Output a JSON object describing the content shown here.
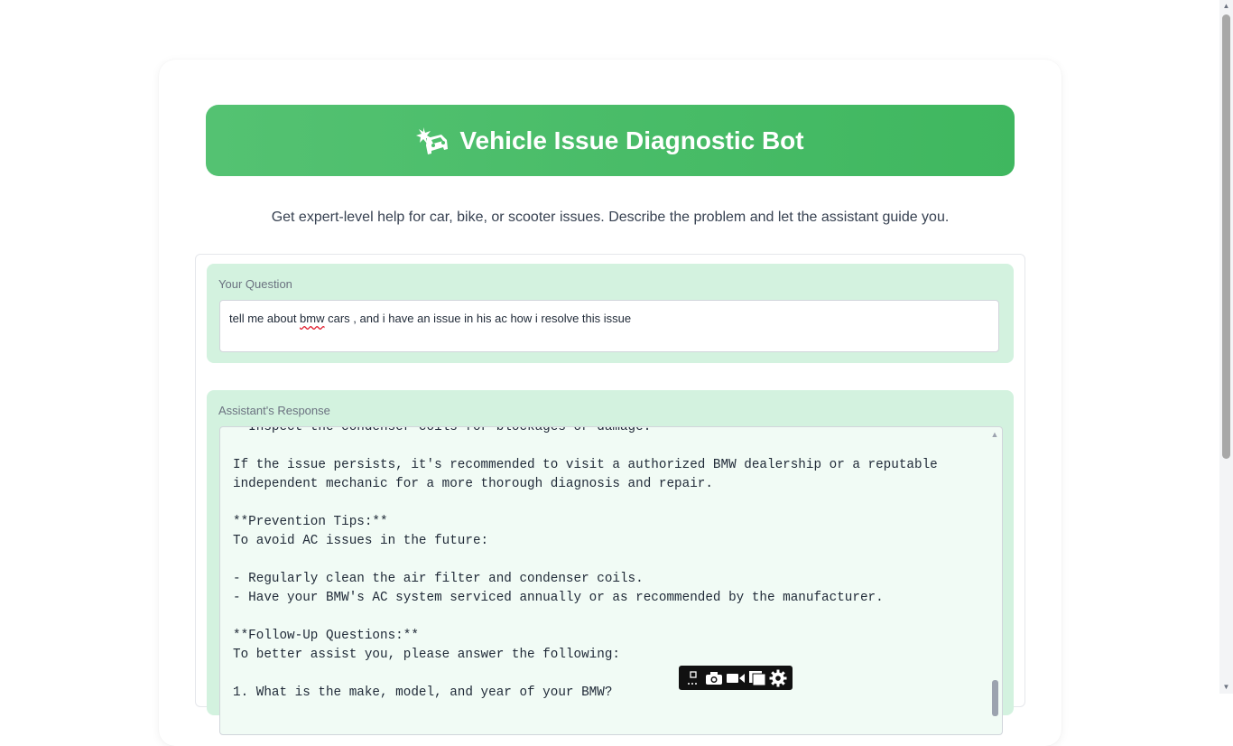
{
  "header": {
    "title": "Vehicle Issue Diagnostic Bot",
    "icon": "car-crash-icon"
  },
  "subtitle": "Get expert-level help for car, bike, or scooter issues. Describe the problem and let the assistant guide you.",
  "question": {
    "label": "Your Question",
    "value_before": "tell me about ",
    "value_misspelled": "bmw",
    "value_after": " cars , and i have an issue in his ac how i resolve this issue"
  },
  "response": {
    "label": "Assistant's Response",
    "text": "- Inspect the condenser coils for blockages or damage.\n\nIf the issue persists, it's recommended to visit a authorized BMW dealership or a reputable\nindependent mechanic for a more thorough diagnosis and repair.\n\n**Prevention Tips:**\nTo avoid AC issues in the future:\n\n- Regularly clean the air filter and condenser coils.\n- Have your BMW's AC system serviced annually or as recommended by the manufacturer.\n\n**Follow-Up Questions:**\nTo better assist you, please answer the following:\n\n1. What is the make, model, and year of your BMW?"
  },
  "toolbar": {
    "icons": [
      "screenshot-area-icon",
      "camera-icon",
      "video-icon",
      "copy-icon",
      "settings-icon"
    ]
  }
}
